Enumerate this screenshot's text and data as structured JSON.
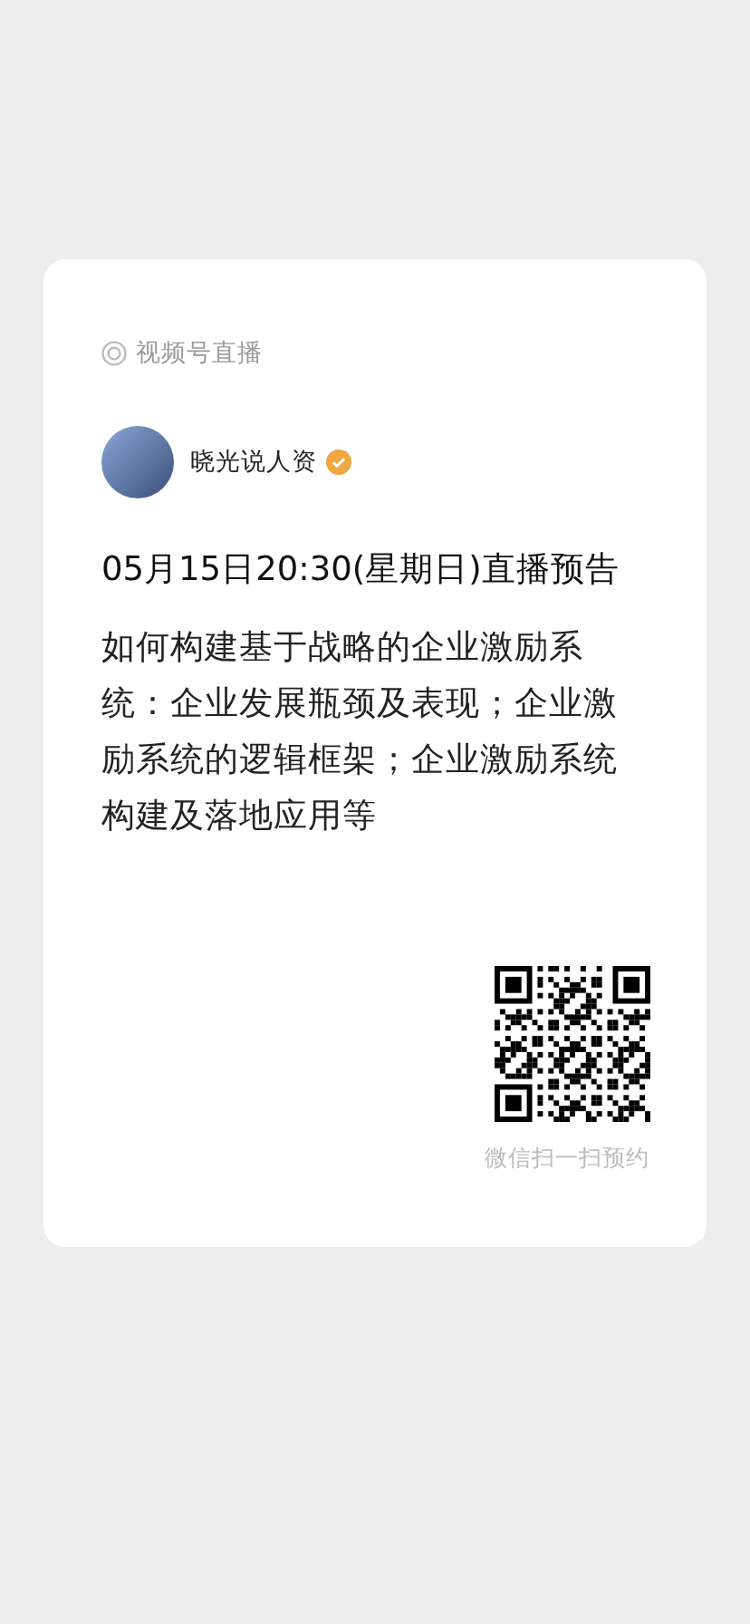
{
  "source_label": "视频号直播",
  "account": {
    "name": "晓光说人资",
    "verified": true
  },
  "title": "05月15日20:30(星期日)直播预告",
  "description": "如何构建基于战略的企业激励系统：企业发展瓶颈及表现；企业激励系统的逻辑框架；企业激励系统构建及落地应用等",
  "qr_caption": "微信扫一扫预约"
}
